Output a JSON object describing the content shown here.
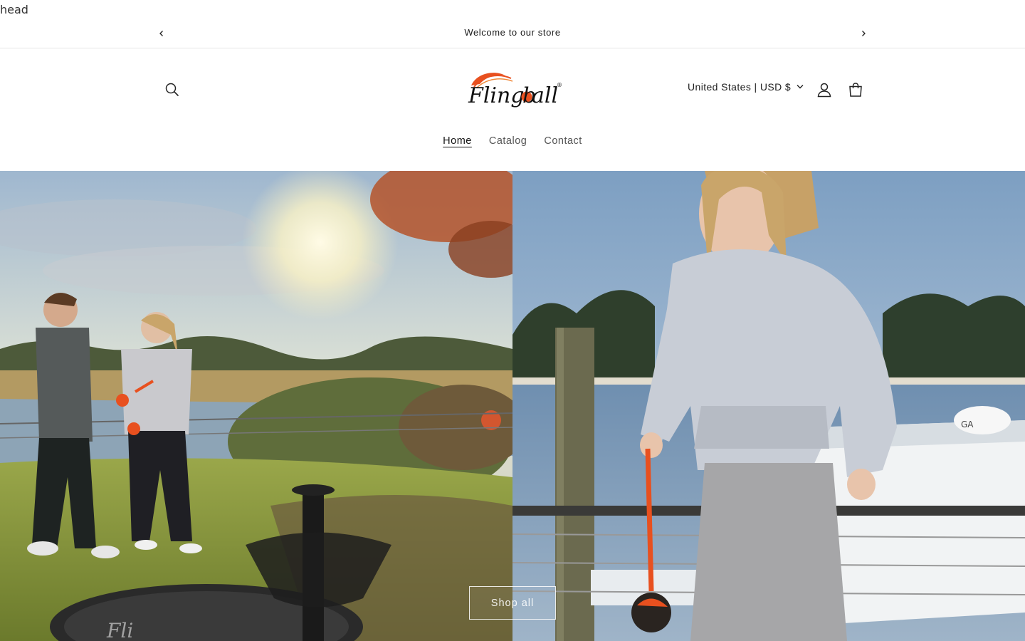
{
  "debug": {
    "text": "head"
  },
  "announcement": {
    "message": "Welcome to our store",
    "prev_icon": "chevron-left-icon",
    "next_icon": "chevron-right-icon"
  },
  "header": {
    "logo_text": "Flingball",
    "logo_mark": "®",
    "country_selector": "United States | USD $",
    "icons": {
      "search": "search-icon",
      "account": "account-icon",
      "cart": "cart-icon",
      "dropdown": "chevron-down-icon"
    }
  },
  "nav": {
    "items": [
      {
        "label": "Home",
        "active": true
      },
      {
        "label": "Catalog",
        "active": false
      },
      {
        "label": "Contact",
        "active": false
      }
    ]
  },
  "hero": {
    "cta_label": "Shop all",
    "left_image": "Two teens playing Flingball on a lawn by a marsh at sunset",
    "right_image": "Girl in grey hoodie holding a Flingball on a dock by the water"
  },
  "colors": {
    "accent": "#e8501f",
    "text": "#121212",
    "muted": "#555555"
  }
}
